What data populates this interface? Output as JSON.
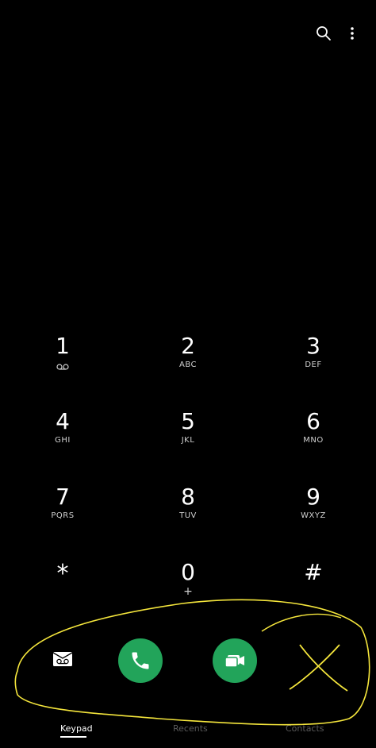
{
  "keys": [
    {
      "digit": "1",
      "letters": ""
    },
    {
      "digit": "2",
      "letters": "ABC"
    },
    {
      "digit": "3",
      "letters": "DEF"
    },
    {
      "digit": "4",
      "letters": "GHI"
    },
    {
      "digit": "5",
      "letters": "JKL"
    },
    {
      "digit": "6",
      "letters": "MNO"
    },
    {
      "digit": "7",
      "letters": "PQRS"
    },
    {
      "digit": "8",
      "letters": "TUV"
    },
    {
      "digit": "9",
      "letters": "WXYZ"
    },
    {
      "digit": "*",
      "letters": ""
    },
    {
      "digit": "0",
      "letters": "+"
    },
    {
      "digit": "#",
      "letters": ""
    }
  ],
  "top_icons": [
    "search-icon",
    "more-options-icon"
  ],
  "actions": {
    "voicemail_icon": "voicemail-icon",
    "call_icon": "phone-icon",
    "video_icon": "video-call-icon",
    "call_color": "#22a45a"
  },
  "tabs": [
    {
      "label": "Keypad",
      "active": true
    },
    {
      "label": "Recents",
      "active": false
    },
    {
      "label": "Contacts",
      "active": false
    }
  ],
  "annotation_color": "#f5e63c"
}
